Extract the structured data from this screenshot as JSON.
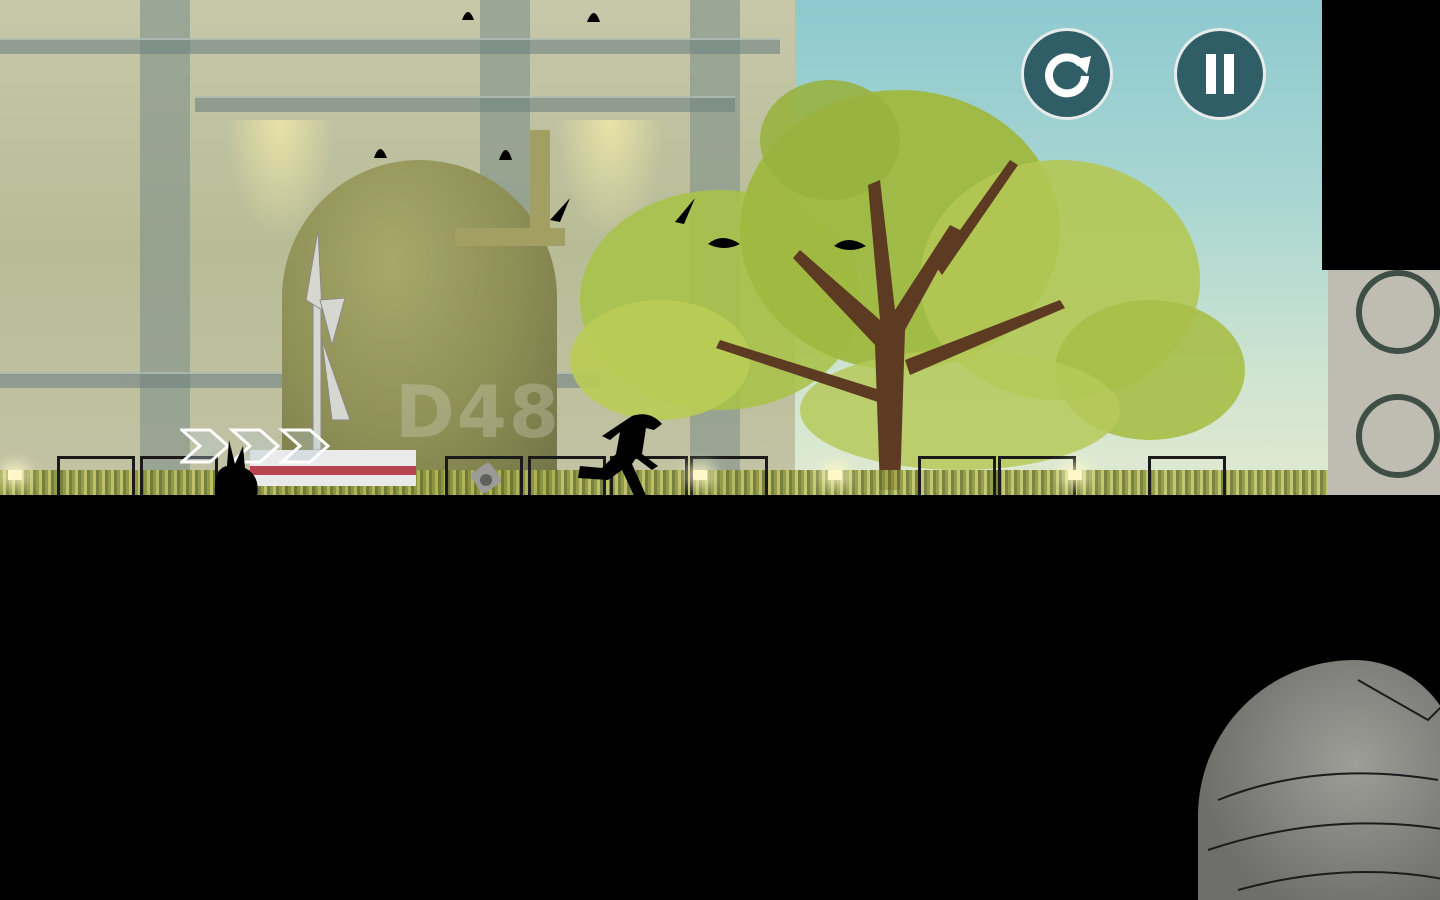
{
  "hud": {
    "restart_button": {
      "icon": "restart-icon"
    },
    "pause_button": {
      "icon": "pause-icon"
    }
  },
  "scene": {
    "sign_text": "D48",
    "colors": {
      "hud_button_fill": "#2f5e67",
      "hud_button_ring": "#e7eceb",
      "sky": "#a9d6d2",
      "factory": "#b8bc96",
      "foliage": "#9fb83f",
      "ground": "#000000"
    },
    "chevron_count": 3,
    "icons": [
      "restart-icon",
      "pause-icon",
      "speed-chevron-icon"
    ]
  }
}
